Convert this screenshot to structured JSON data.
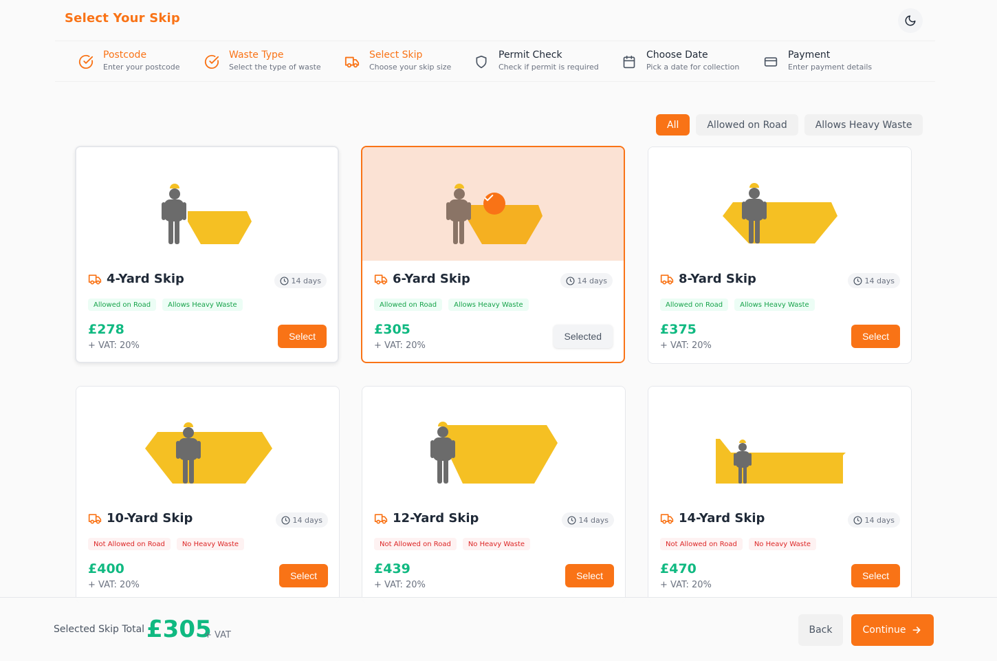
{
  "header": {
    "title": "Select Your Skip",
    "theme_icon": "moon-icon"
  },
  "steps": [
    {
      "label": "Postcode",
      "sub": "Enter your postcode",
      "state": "done",
      "icon": "check-circle-icon"
    },
    {
      "label": "Waste Type",
      "sub": "Select the type of waste",
      "state": "done",
      "icon": "check-circle-icon"
    },
    {
      "label": "Select Skip",
      "sub": "Choose your skip size",
      "state": "current",
      "icon": "truck-icon"
    },
    {
      "label": "Permit Check",
      "sub": "Check if permit is required",
      "state": "todo",
      "icon": "shield-icon"
    },
    {
      "label": "Choose Date",
      "sub": "Pick a date for collection",
      "state": "todo",
      "icon": "calendar-icon"
    },
    {
      "label": "Payment",
      "sub": "Enter payment details",
      "state": "todo",
      "icon": "credit-card-icon"
    }
  ],
  "filters": {
    "all": "All",
    "road": "Allowed on Road",
    "heavy": "Allows Heavy Waste",
    "active": "All"
  },
  "skips": [
    {
      "name": "4-Yard Skip",
      "days": "14 days",
      "tags": [
        "Allowed on Road",
        "Allows Heavy Waste"
      ],
      "ok": true,
      "price": "£278",
      "vat": "+ VAT: 20%",
      "button": "Select"
    },
    {
      "name": "6-Yard Skip",
      "days": "14 days",
      "tags": [
        "Allowed on Road",
        "Allows Heavy Waste"
      ],
      "ok": true,
      "price": "£305",
      "vat": "+ VAT: 20%",
      "button": "Selected",
      "selected": true
    },
    {
      "name": "8-Yard Skip",
      "days": "14 days",
      "tags": [
        "Allowed on Road",
        "Allows Heavy Waste"
      ],
      "ok": true,
      "price": "£375",
      "vat": "+ VAT: 20%",
      "button": "Select"
    },
    {
      "name": "10-Yard Skip",
      "days": "14 days",
      "tags": [
        "Not Allowed on Road",
        "No Heavy Waste"
      ],
      "ok": false,
      "price": "£400",
      "vat": "+ VAT: 20%",
      "button": "Select"
    },
    {
      "name": "12-Yard Skip",
      "days": "14 days",
      "tags": [
        "Not Allowed on Road",
        "No Heavy Waste"
      ],
      "ok": false,
      "price": "£439",
      "vat": "+ VAT: 20%",
      "button": "Select"
    },
    {
      "name": "14-Yard Skip",
      "days": "14 days",
      "tags": [
        "Not Allowed on Road",
        "No Heavy Waste"
      ],
      "ok": false,
      "price": "£470",
      "vat": "+ VAT: 20%",
      "button": "Select"
    }
  ],
  "footer": {
    "label": "Selected Skip Total",
    "total": "£305",
    "vat": "+ VAT",
    "back": "Back",
    "continue": "Continue"
  },
  "colors": {
    "accent": "#f97316",
    "price": "#10b981",
    "skip": "#f5c023",
    "person": "#6b6b6b"
  }
}
